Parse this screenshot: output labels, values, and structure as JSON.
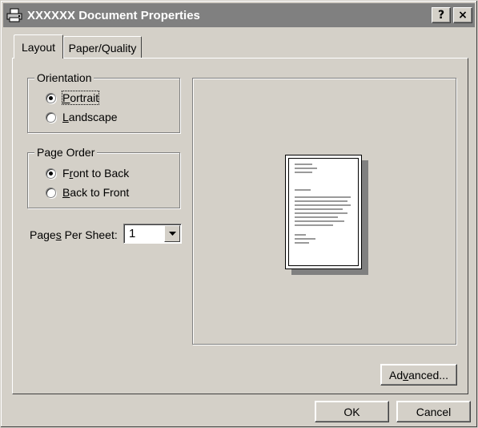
{
  "window": {
    "title": "XXXXXX Document Properties",
    "help_button": "?",
    "close_button": "×"
  },
  "tabs": [
    {
      "label": "Layout",
      "active": true
    },
    {
      "label": "Paper/Quality",
      "active": false
    }
  ],
  "orientation": {
    "title": "Orientation",
    "options": [
      {
        "pre": "",
        "key": "P",
        "post": "ortrait",
        "selected": true,
        "focused": true
      },
      {
        "pre": "",
        "key": "L",
        "post": "andscape",
        "selected": false,
        "focused": false
      }
    ]
  },
  "page_order": {
    "title": "Page Order",
    "options": [
      {
        "pre": "F",
        "key": "r",
        "post": "ont to Back",
        "selected": true
      },
      {
        "pre": "",
        "key": "B",
        "post": "ack to Front",
        "selected": false
      }
    ]
  },
  "pages_per_sheet": {
    "label_pre": "Page",
    "label_key": "s",
    "label_post": " Per Sheet:",
    "value": "1"
  },
  "buttons": {
    "advanced_pre": "Ad",
    "advanced_key": "v",
    "advanced_post": "anced...",
    "ok": "OK",
    "cancel": "Cancel"
  },
  "colors": {
    "face": "#d4d0c8",
    "titlebar": "#808080",
    "shadow": "#808080",
    "highlight": "#ffffff"
  },
  "icons": {
    "title": "printer-icon",
    "dropdown": "chevron-down-icon"
  }
}
